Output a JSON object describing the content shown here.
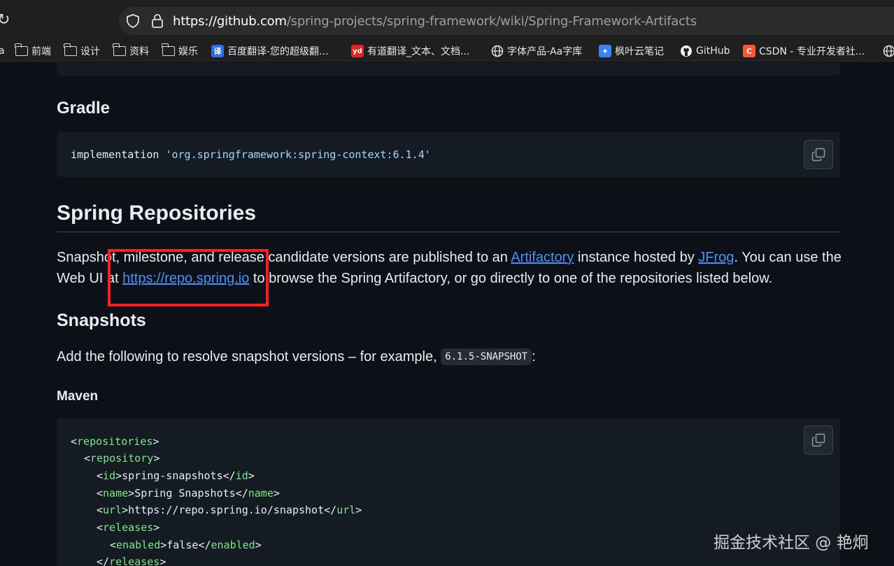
{
  "browser": {
    "url_host": "https://github.com",
    "url_path": "/spring-projects/spring-framework/wiki/Spring-Framework-Artifacts",
    "bookmarks": [
      {
        "label": "a"
      },
      {
        "label": "前端"
      },
      {
        "label": "设计"
      },
      {
        "label": "资料"
      },
      {
        "label": "娱乐"
      },
      {
        "label": "百度翻译-您的超级翻..."
      },
      {
        "label": "有道翻译_文本、文档..."
      },
      {
        "label": "字体产品-Aa字库"
      },
      {
        "label": "枫叶云笔记"
      },
      {
        "label": "GitHub"
      },
      {
        "label": "CSDN - 专业开发者社..."
      }
    ]
  },
  "page": {
    "gradle_heading": "Gradle",
    "gradle_code_kw": "implementation ",
    "gradle_code_str": "'org.springframework:spring-context:6.1.4'",
    "repo_heading": "Spring Repositories",
    "p1_a": "Snapshot, milestone, and release candidate versions are published to an ",
    "p1_link1": "Artifactory",
    "p1_b": " instance hosted by ",
    "p1_link2": "JFrog",
    "p1_c": ". You can use the",
    "p2_a": "Web UI at ",
    "p2_link": "https://repo.spring.io",
    "p2_b": " to browse the Spring Artifactory, or go directly to one of the repositories listed below.",
    "snap_heading": "Snapshots",
    "p3_a": "Add the following to resolve snapshot versions – for example, ",
    "p3_code": "6.1.5-SNAPSHOT",
    "p3_b": ":",
    "maven_heading": "Maven",
    "maven_lines": {
      "l1": "repositories",
      "l2": "repository",
      "l3_tag": "id",
      "l3_val": "spring-snapshots",
      "l4_tag": "name",
      "l4_val": "Spring Snapshots",
      "l5_tag": "url",
      "l5_val": "https://repo.spring.io/snapshot",
      "l6": "releases",
      "l7_tag": "enabled",
      "l7_val": "false",
      "l8": "releases"
    }
  },
  "watermark": "掘金技术社区 @ 艳炯",
  "colors": {
    "background": "#0d1117",
    "code_bg": "#151b23",
    "link": "#4493f8",
    "tag": "#7ee787",
    "string": "#a5d6ff",
    "highlight_box": "#ff1f1f"
  }
}
